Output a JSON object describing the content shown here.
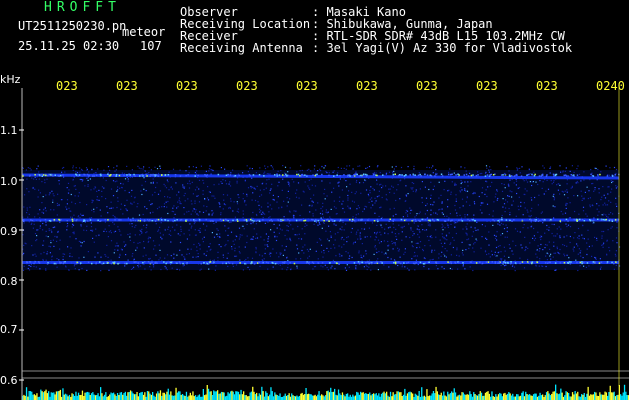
{
  "header": {
    "brand": "HROFFT",
    "filename": "UT2511250230.pn",
    "mode": "meteor",
    "datetime": "25.11.25 02:30",
    "count": "107",
    "fields": [
      {
        "label": "Observer",
        "value": ": Masaki Kano"
      },
      {
        "label": "Receiving Location",
        "value": ": Shibukawa, Gunma, Japan"
      },
      {
        "label": "Receiver",
        "value": ": RTL-SDR SDR# 43dB L15 103.2MHz CW"
      },
      {
        "label": "Receiving Antenna",
        "value": ": 3el Yagi(V) Az 330 for Vladivostok"
      }
    ]
  },
  "axes": {
    "y_unit": "kHz",
    "y_ticks": [
      "1.1",
      "1.0",
      "0.9",
      "0.8",
      "0.7",
      "0.6"
    ],
    "x_ticks": [
      "023",
      "023",
      "023",
      "023",
      "023",
      "023",
      "023",
      "023",
      "023",
      "0240"
    ]
  },
  "signal_bands_khz": [
    1.01,
    0.92,
    0.835
  ],
  "colors": {
    "background": "#000000",
    "header_text": "#ffffff",
    "time_text": "#ffff33",
    "brand": "#33ff66",
    "band": "#1a3cff",
    "noise_yellow": "#ffff33",
    "noise_cyan": "#00e5ff"
  }
}
